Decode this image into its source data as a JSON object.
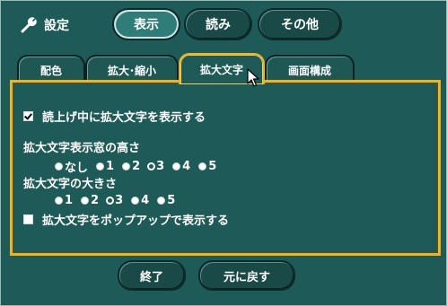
{
  "header": {
    "title": "設定",
    "icon": "wrench-icon",
    "buttons": [
      {
        "label": "表示",
        "active": true
      },
      {
        "label": "読み",
        "active": false
      },
      {
        "label": "その他",
        "active": false
      }
    ]
  },
  "tabs": [
    {
      "label": "配色"
    },
    {
      "label": "拡大･縮小"
    },
    {
      "label": "拡大文字",
      "active": true
    },
    {
      "label": "画面構成"
    }
  ],
  "panel": {
    "show_large_text_while_reading": {
      "label": "読上げ中に拡大文字を表示する",
      "checked": true
    },
    "window_height": {
      "label": "拡大文字表示窓の高さ",
      "options": [
        "なし",
        "1",
        "2",
        "3",
        "4",
        "5"
      ],
      "selected": "3"
    },
    "text_size": {
      "label": "拡大文字の大きさ",
      "options": [
        "1",
        "2",
        "3",
        "4",
        "5"
      ],
      "selected": "3"
    },
    "popup": {
      "label": "拡大文字をポップアップで表示する",
      "checked": false
    }
  },
  "footer": {
    "finish_label": "終了",
    "reset_label": "元に戻す"
  },
  "colors": {
    "background": "#1e5a58",
    "accent": "#e8b42a"
  }
}
